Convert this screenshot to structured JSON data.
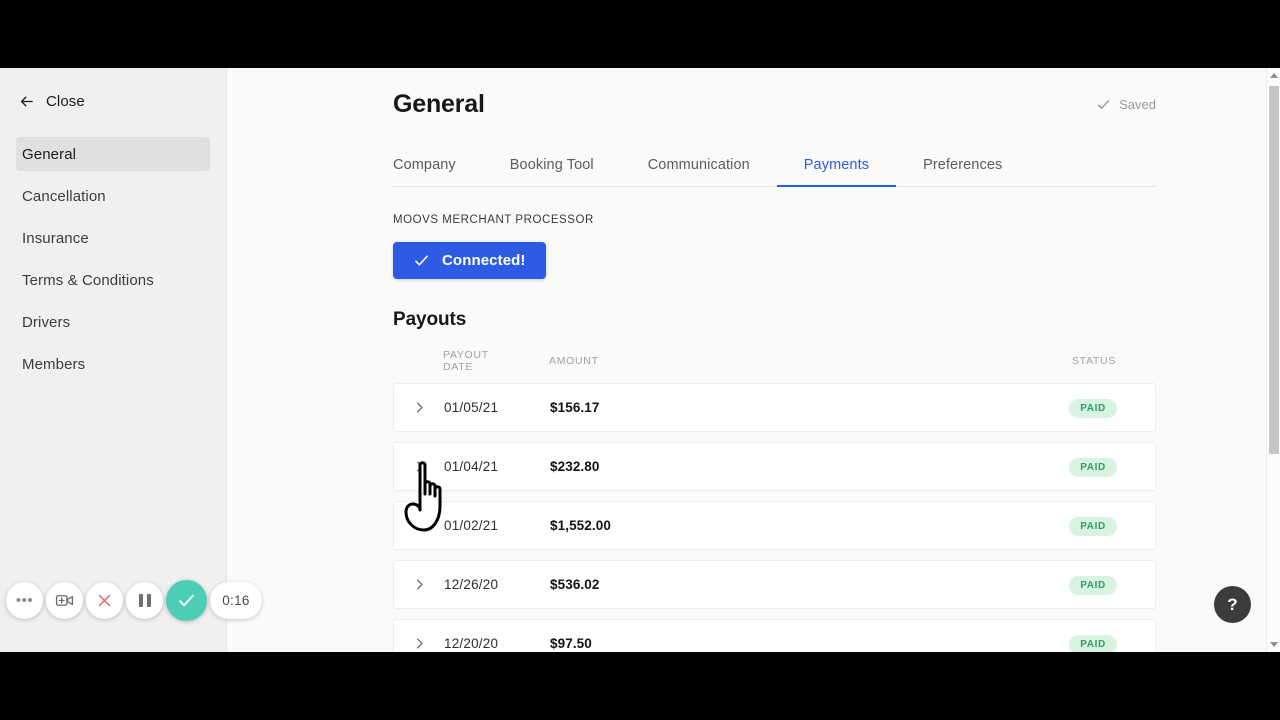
{
  "sidebar": {
    "close_label": "Close",
    "close_icon": "arrow-left-icon",
    "items": [
      {
        "label": "General",
        "active": true
      },
      {
        "label": "Cancellation",
        "active": false
      },
      {
        "label": "Insurance",
        "active": false
      },
      {
        "label": "Terms & Conditions",
        "active": false
      },
      {
        "label": "Drivers",
        "active": false
      },
      {
        "label": "Members",
        "active": false
      }
    ]
  },
  "header": {
    "title": "General",
    "saved_label": "Saved",
    "saved_icon": "check-icon"
  },
  "tabs": [
    {
      "label": "Company",
      "active": false
    },
    {
      "label": "Booking Tool",
      "active": false
    },
    {
      "label": "Communication",
      "active": false
    },
    {
      "label": "Payments",
      "active": true
    },
    {
      "label": "Preferences",
      "active": false
    }
  ],
  "processor": {
    "eyebrow": "MOOVS MERCHANT PROCESSOR",
    "button_label": "Connected!",
    "button_icon": "check-icon",
    "button_color": "#2d5be3"
  },
  "payouts": {
    "title": "Payouts",
    "columns": [
      "PAYOUT DATE",
      "AMOUNT",
      "STATUS"
    ],
    "row_icon": "chevron-right-icon",
    "rows": [
      {
        "date": "01/05/21",
        "amount": "$156.17",
        "status": "PAID"
      },
      {
        "date": "01/04/21",
        "amount": "$232.80",
        "status": "PAID"
      },
      {
        "date": "01/02/21",
        "amount": "$1,552.00",
        "status": "PAID"
      },
      {
        "date": "12/26/20",
        "amount": "$536.02",
        "status": "PAID"
      },
      {
        "date": "12/20/20",
        "amount": "$97.50",
        "status": "PAID"
      }
    ],
    "badge_bg": "#d8f3e1",
    "badge_fg": "#2f9e63"
  },
  "help": {
    "label": "?"
  },
  "recorder": {
    "more_label": "•••",
    "timer": "0:16",
    "buttons": [
      {
        "name": "more-options",
        "icon": "ellipsis-icon"
      },
      {
        "name": "add-clip",
        "icon": "add-video-icon"
      },
      {
        "name": "cancel-recording",
        "icon": "close-icon"
      },
      {
        "name": "pause-recording",
        "icon": "pause-icon"
      },
      {
        "name": "finish-recording",
        "icon": "check-icon"
      }
    ],
    "accent_color": "#4ecdb6"
  },
  "cursor": {
    "icon": "pointing-hand-cursor"
  }
}
